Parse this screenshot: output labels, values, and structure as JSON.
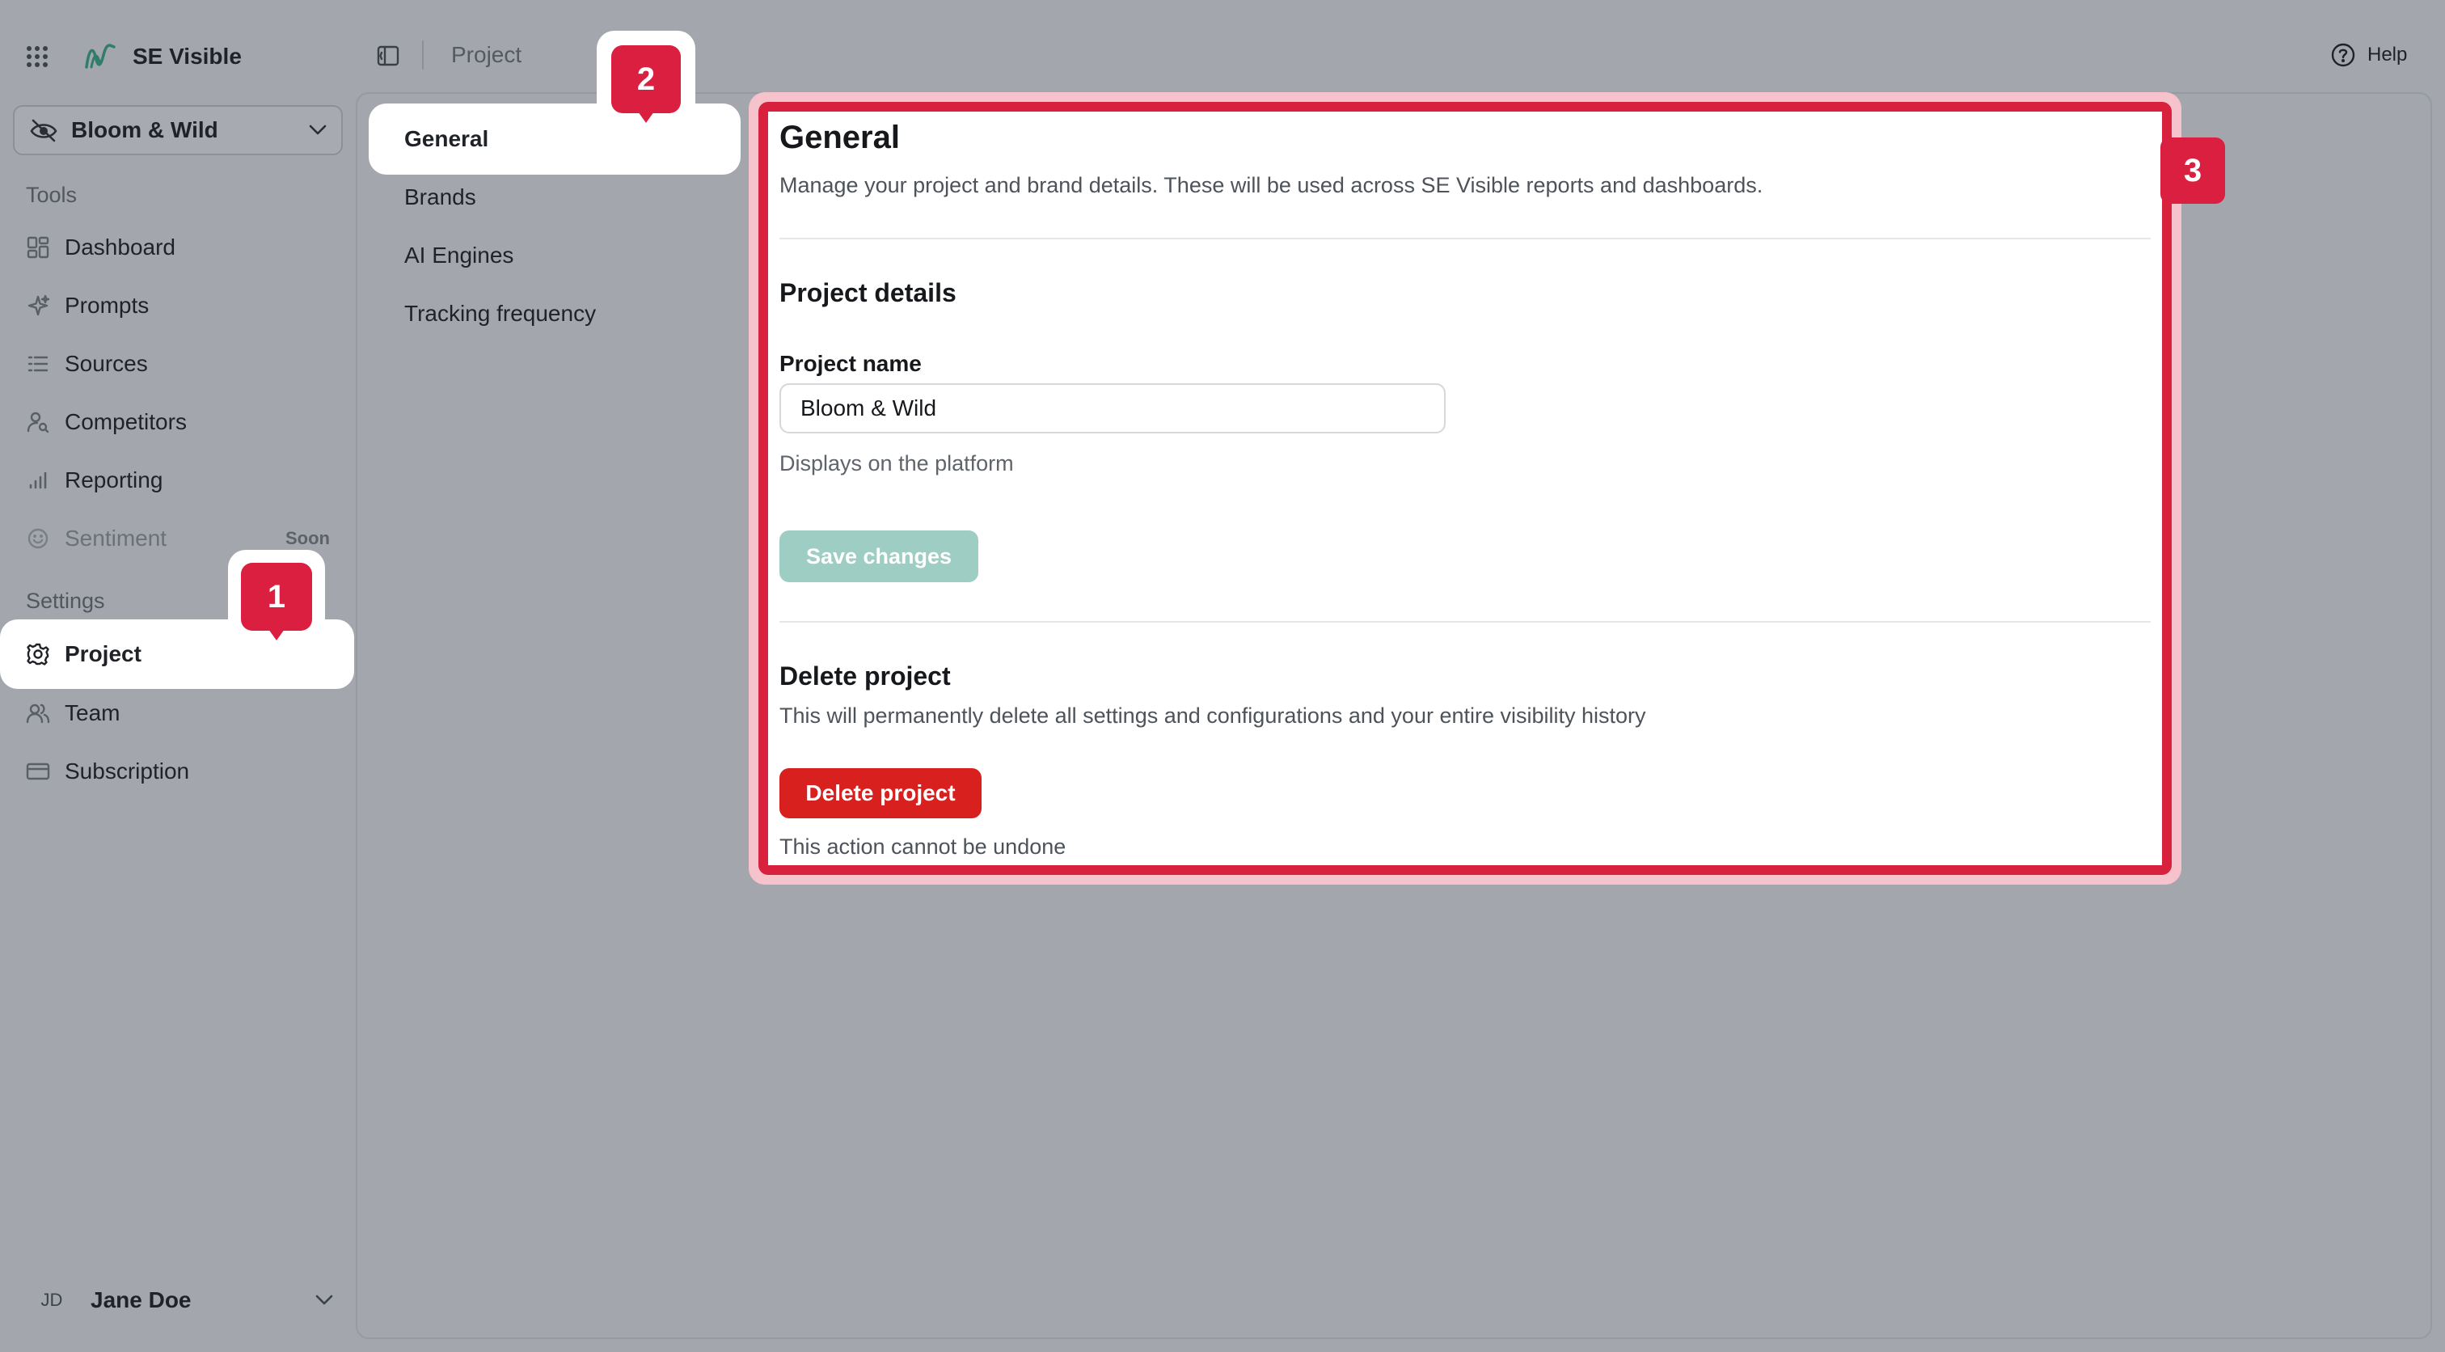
{
  "app": {
    "name": "SE Visible",
    "apps_icon": "grid-dots-icon",
    "logo_icon": "se-visible-logo"
  },
  "project_selector": {
    "value": "Bloom & Wild",
    "icon": "leaf-eye-icon"
  },
  "sidebar": {
    "tools_label": "Tools",
    "tools": [
      {
        "label": "Dashboard",
        "icon": "dashboard-icon"
      },
      {
        "label": "Prompts",
        "icon": "sparkles-icon"
      },
      {
        "label": "Sources",
        "icon": "list-icon"
      },
      {
        "label": "Competitors",
        "icon": "user-search-icon"
      },
      {
        "label": "Reporting",
        "icon": "bar-chart-icon"
      },
      {
        "label": "Sentiment",
        "icon": "smile-icon",
        "badge": "Soon"
      }
    ],
    "settings_label": "Settings",
    "settings": [
      {
        "label": "Project",
        "icon": "gear-icon"
      },
      {
        "label": "Team",
        "icon": "users-icon"
      },
      {
        "label": "Subscription",
        "icon": "credit-card-icon"
      }
    ]
  },
  "user": {
    "initials": "JD",
    "name": "Jane Doe"
  },
  "topbar": {
    "breadcrumb": "Project",
    "help": "Help"
  },
  "subnav": [
    "General",
    "Brands",
    "AI Engines",
    "Tracking frequency"
  ],
  "general": {
    "title": "General",
    "description": "Manage your project and brand details. These will be used across SE Visible reports and dashboards.",
    "project_details_heading": "Project details",
    "project_name_label": "Project name",
    "project_name_value": "Bloom & Wild",
    "project_name_hint": "Displays on the platform",
    "save_label": "Save changes",
    "delete_heading": "Delete project",
    "delete_description": "This will permanently delete all settings and configurations and your entire visibility history",
    "delete_label": "Delete project",
    "delete_hint": "This action cannot be undone"
  },
  "markers": [
    "1",
    "2",
    "3"
  ],
  "colors": {
    "accent": "#d8213d",
    "save_button": "#9ecdc3",
    "delete_button": "#d8211f"
  }
}
